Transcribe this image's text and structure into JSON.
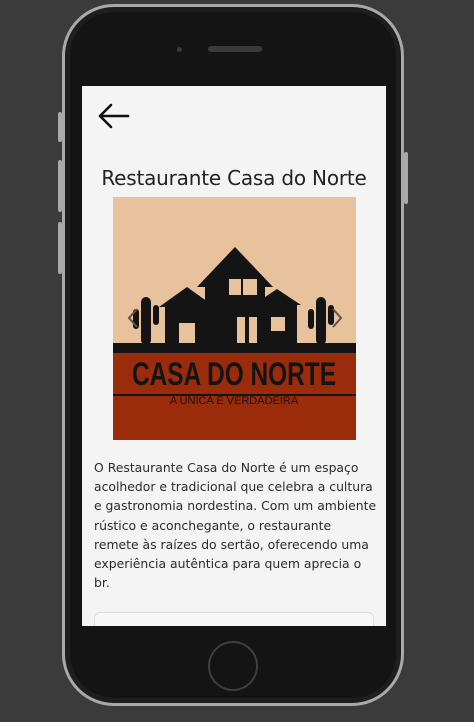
{
  "screen": {
    "back_icon": "arrow-left-icon",
    "title": "Restaurante Casa do Norte",
    "carousel": {
      "prev_icon": "chevron-left-icon",
      "next_icon": "chevron-right-icon",
      "logo": {
        "main_text": "CASA DO NORTE",
        "tagline": "A ÚNICA E VERDADEIRA"
      }
    },
    "description": "O Restaurante Casa do Norte é um espaço acolhedor e tradicional que celebra a cultura e gastronomia nordestina. Com um ambiente rústico e aconchegante, o restaurante remete às raízes do sertão, oferecendo uma experiência autêntica para quem aprecia o br."
  },
  "colors": {
    "logo_sky": "#e8c29c",
    "logo_ground": "#9a2c0c",
    "logo_ink": "#141414"
  }
}
